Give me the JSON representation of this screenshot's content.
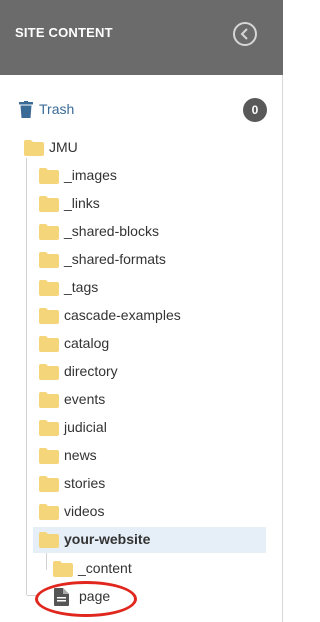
{
  "panel": {
    "title": "SITE CONTENT",
    "collapse_icon": "chevron-left-circle-icon"
  },
  "trash": {
    "label": "Trash",
    "count": "0",
    "icon": "trash-icon",
    "color": "#3a6b96"
  },
  "tree": {
    "root": {
      "label": "JMU",
      "icon": "folder-icon"
    },
    "children": [
      {
        "label": "_images"
      },
      {
        "label": "_links"
      },
      {
        "label": "_shared-blocks"
      },
      {
        "label": "_shared-formats"
      },
      {
        "label": "_tags"
      },
      {
        "label": "cascade-examples"
      },
      {
        "label": "catalog"
      },
      {
        "label": "directory"
      },
      {
        "label": "events"
      },
      {
        "label": "judicial"
      },
      {
        "label": "news"
      },
      {
        "label": "stories"
      },
      {
        "label": "videos"
      },
      {
        "label": "your-website",
        "selected": true
      }
    ],
    "your_website_children": [
      {
        "label": "_content",
        "icon": "folder-icon"
      },
      {
        "label": "page",
        "icon": "page-file-icon"
      }
    ]
  },
  "colors": {
    "header_bg": "#6b6b6b",
    "folder": "#f5d57a",
    "selected_bg": "#e6eff7",
    "annotation": "#e0261d"
  }
}
